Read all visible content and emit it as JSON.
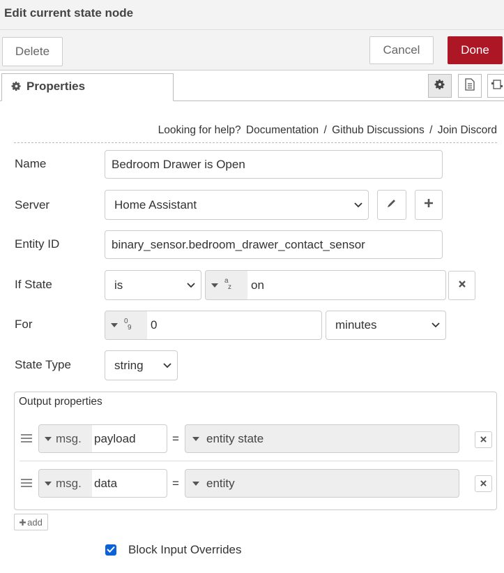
{
  "header": {
    "title": "Edit current state node"
  },
  "toolbar": {
    "delete_label": "Delete",
    "cancel_label": "Cancel",
    "done_label": "Done"
  },
  "tabs": {
    "properties_label": "Properties"
  },
  "help": {
    "prefix": "Looking for help?",
    "links": [
      "Documentation",
      "Github Discussions",
      "Join Discord"
    ],
    "separator": "/"
  },
  "form": {
    "name": {
      "label": "Name",
      "value": "Bedroom Drawer is Open"
    },
    "server": {
      "label": "Server",
      "value": "Home Assistant"
    },
    "entity": {
      "label": "Entity ID",
      "value": "binary_sensor.bedroom_drawer_contact_sensor"
    },
    "if_state": {
      "label": "If State",
      "operator": "is",
      "type_icon": "az-string-icon",
      "value": "on"
    },
    "for": {
      "label": "For",
      "type_icon": "09-number-icon",
      "value": "0",
      "unit": "minutes"
    },
    "state_type": {
      "label": "State Type",
      "value": "string"
    }
  },
  "output": {
    "legend": "Output properties",
    "rows": [
      {
        "prefix": "msg.",
        "property": "payload",
        "equals": "=",
        "value": "entity state"
      },
      {
        "prefix": "msg.",
        "property": "data",
        "equals": "=",
        "value": "entity"
      }
    ],
    "add_label": "add"
  },
  "options": {
    "block_input_overrides_label": "Block Input Overrides",
    "block_input_overrides_checked": true
  },
  "colors": {
    "primary": "#ad1625",
    "checkbox": "#0b62d8"
  }
}
